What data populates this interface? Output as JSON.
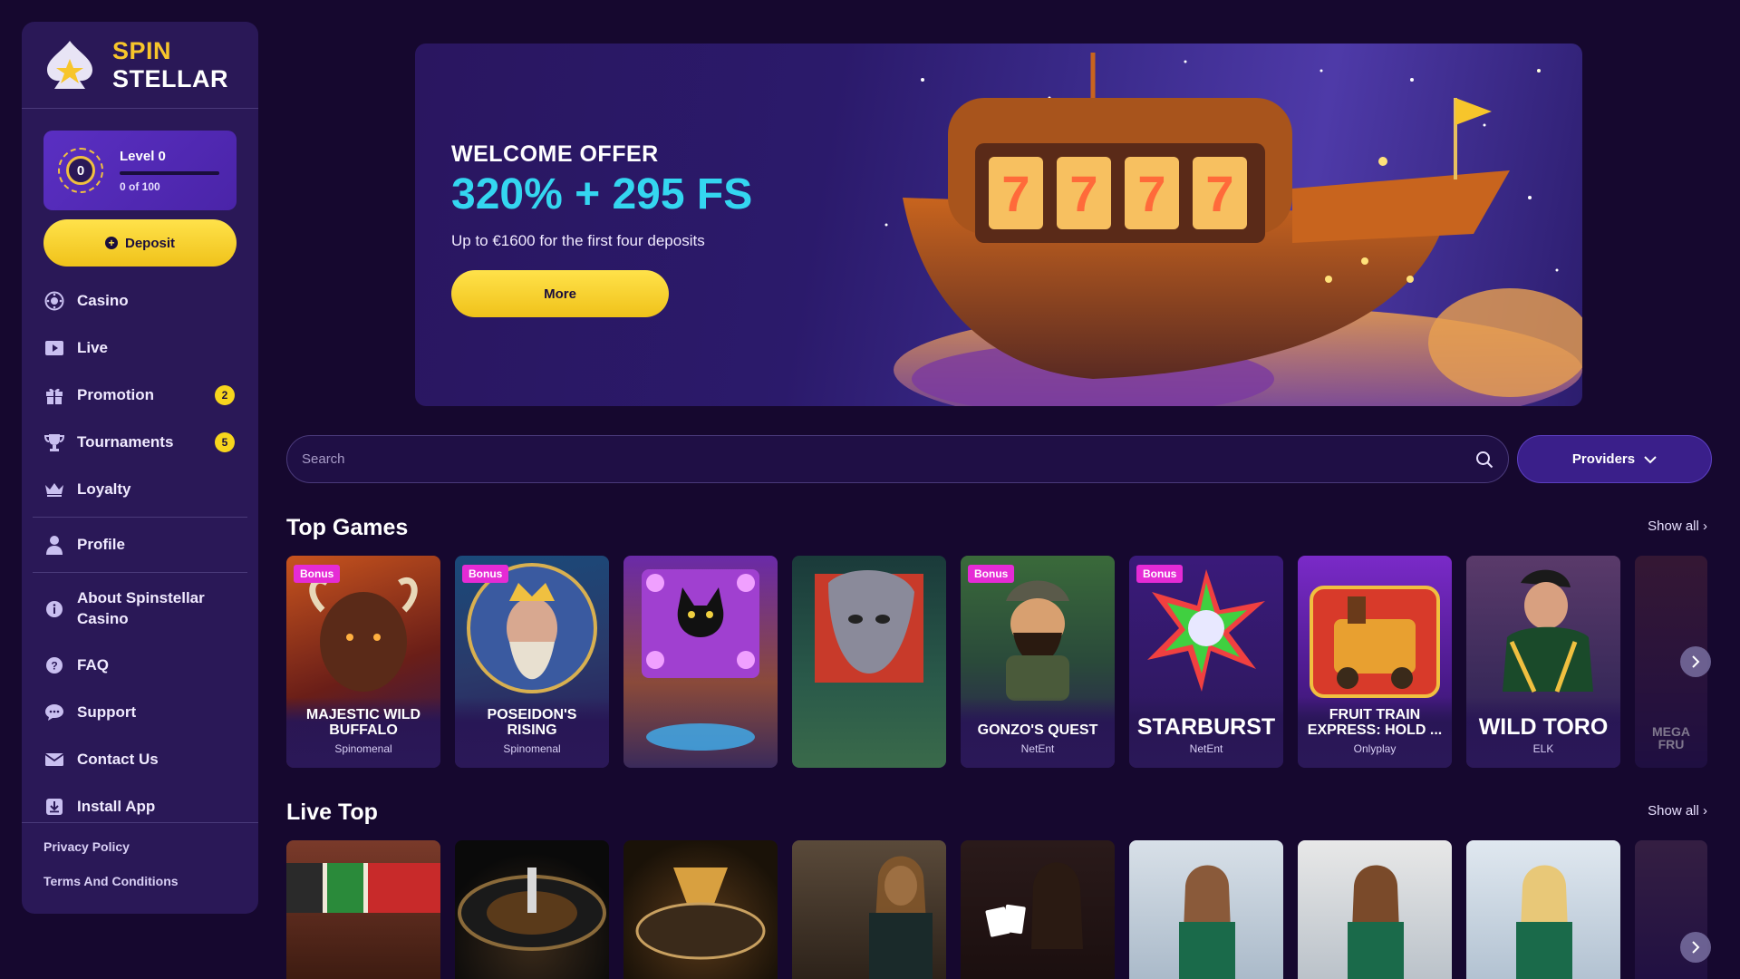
{
  "brand": {
    "line1": "SPIN",
    "line2": "STELLAR"
  },
  "level": {
    "badge": "0",
    "title": "Level 0",
    "progress": "0 of 100",
    "fraction": 0
  },
  "deposit_label": "Deposit",
  "nav": {
    "casino": "Casino",
    "live": "Live",
    "promotion": "Promotion",
    "promotion_badge": "2",
    "tournaments": "Tournaments",
    "tournaments_badge": "5",
    "loyalty": "Loyalty",
    "profile": "Profile",
    "about": "About Spinstellar Casino",
    "faq": "FAQ",
    "support": "Support",
    "contact": "Contact Us",
    "install": "Install App"
  },
  "footer": {
    "privacy": "Privacy Policy",
    "terms": "Terms And Conditions"
  },
  "banner": {
    "welcome": "WELCOME OFFER",
    "offer": "320% + 295 FS",
    "subtitle": "Up to €1600 for the first four deposits",
    "button": "More"
  },
  "search": {
    "placeholder": "Search"
  },
  "providers_label": "Providers",
  "top_games": {
    "title": "Top Games",
    "show_all": "Show all",
    "bonus_label": "Bonus",
    "games": [
      {
        "name": "MAJESTIC WILD BUFFALO",
        "provider": "Spinomenal",
        "bonus": true
      },
      {
        "name": "POSEIDON'S RISING",
        "provider": "Spinomenal",
        "bonus": true
      },
      {
        "name": "",
        "provider": "",
        "bonus": false
      },
      {
        "name": "",
        "provider": "",
        "bonus": false
      },
      {
        "name": "GONZO'S QUEST",
        "provider": "NetEnt",
        "bonus": true
      },
      {
        "name": "STARBURST",
        "provider": "NetEnt",
        "bonus": true
      },
      {
        "name": "FRUIT TRAIN EXPRESS: HOLD ...",
        "provider": "Onlyplay",
        "bonus": false
      },
      {
        "name": "WILD TORO",
        "provider": "ELK",
        "bonus": false
      },
      {
        "name": "MEGA FRU",
        "provider": "",
        "bonus": false
      }
    ]
  },
  "live_top": {
    "title": "Live Top",
    "show_all": "Show all"
  },
  "colors": {
    "accent": "#f7d51d",
    "bg": "#16082f",
    "sidebar": "#2a1857",
    "offer": "#34d6f0",
    "bonus": "#e52bd5"
  }
}
